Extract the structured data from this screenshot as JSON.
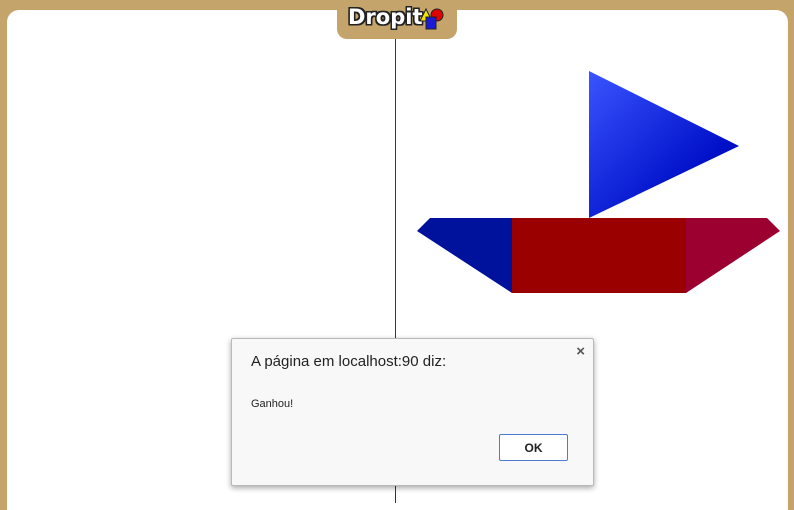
{
  "logo": {
    "text": "Dropit",
    "shapes_icon": "triangle-square-circle-icon"
  },
  "board": {
    "sail_gradient": [
      "#3a55ff",
      "#0010b0"
    ],
    "pieces": [
      {
        "name": "sail-triangle",
        "color": "#1428d6"
      },
      {
        "name": "hull-left-triangle",
        "color": "#00129c"
      },
      {
        "name": "hull-center-rectangle",
        "color": "#9a0000"
      },
      {
        "name": "hull-right-triangle",
        "color": "#9b0030"
      }
    ]
  },
  "dialog": {
    "title": "A página em localhost:90 diz:",
    "message": "Ganhou!",
    "ok_label": "OK",
    "close_icon": "close-icon"
  },
  "colors": {
    "frame": "#c4a46a",
    "background": "#ffffff",
    "divider": "#7a1a1a",
    "ok_border": "#4c7bd0"
  }
}
